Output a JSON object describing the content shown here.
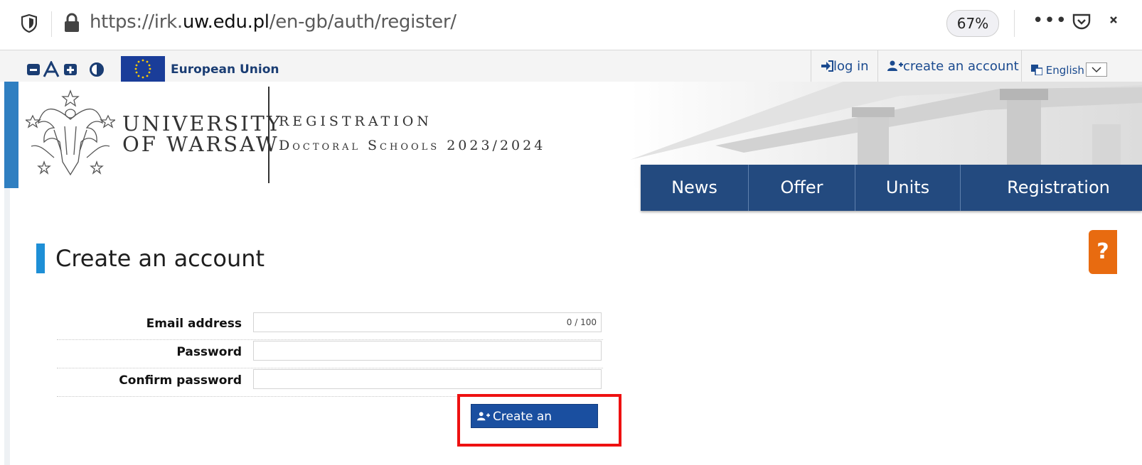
{
  "browser": {
    "url_prefix": "https://irk.",
    "url_domain": "uw.edu.pl",
    "url_path": "/en-gb/auth/register/",
    "zoom": "67%",
    "menu_dots": "•••"
  },
  "topbar": {
    "eu_label": "European Union",
    "login_label": "log in",
    "create_account_label": "create an account",
    "language_label": "English"
  },
  "header": {
    "university_line1": "UNIVERSITY",
    "university_line2": "OF WARSAW",
    "registration_title": "REGISTRATION",
    "registration_subtitle": "Doctoral Schools 2023/2024"
  },
  "nav": {
    "items": [
      "News",
      "Offer",
      "Units",
      "Registration"
    ]
  },
  "help": {
    "label": "?"
  },
  "page": {
    "title": "Create an account"
  },
  "form": {
    "email_label": "Email address",
    "email_counter": "0 / 100",
    "password_label": "Password",
    "confirm_label": "Confirm password",
    "submit_label": "Create an account"
  },
  "colors": {
    "nav_bg": "#234a7f",
    "submit_bg": "#1a4fa0",
    "title_accent": "#1e8fd6",
    "help_tab": "#e86b10",
    "highlight": "#ee1111"
  }
}
